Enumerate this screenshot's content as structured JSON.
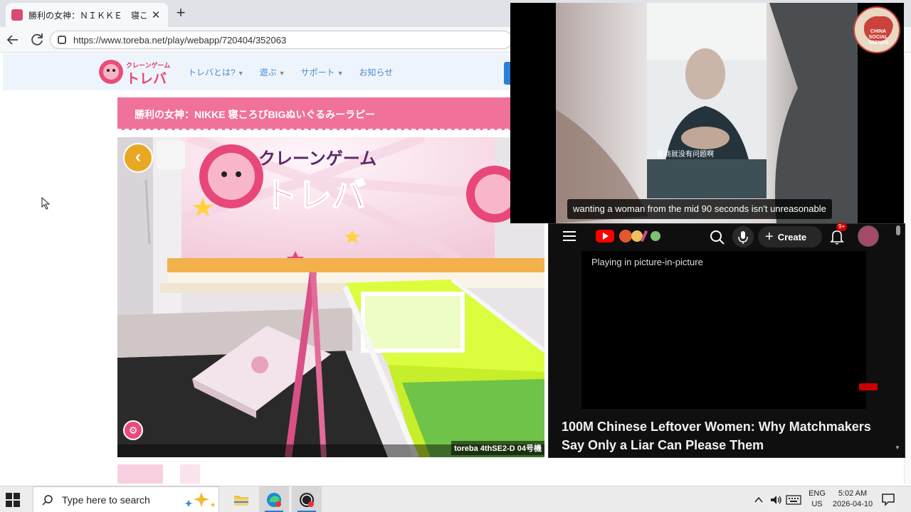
{
  "browser": {
    "tab_title": "勝利の女神：ＮＩＫＫＥ　寝ころび",
    "tab_close": "✕",
    "new_tab": "+",
    "url": "https://www.toreba.net/play/webapp/720404/352063"
  },
  "site": {
    "logo_top": "クレーンゲーム",
    "logo_main": "トレバ",
    "nav": [
      {
        "label": "トレバとは?",
        "has_dropdown": true
      },
      {
        "label": "遊ぶ",
        "has_dropdown": true
      },
      {
        "label": "サポート",
        "has_dropdown": true
      },
      {
        "label": "お知らせ",
        "has_dropdown": false
      }
    ],
    "title": "勝利の女神：NIKKE 寝ころびBIGぬいぐるみーラピー",
    "camera_label": "toreba 4thSE2-D 04号機",
    "game_sign_top": "クレーンゲーム",
    "game_sign_main": "トレバ",
    "back_glyph": "‹"
  },
  "pip": {
    "subtitle": "wanting a woman from the mid 90 seconds isn't unreasonable",
    "inner_subtitle": "智商就没有问题啊",
    "badge_line1": "CHINA",
    "badge_line2": "SOCIAL TRENDS"
  },
  "youtube": {
    "create_label": "Create",
    "notifications": "9+",
    "pip_status": "Playing in picture-in-picture",
    "video_title": "100M Chinese Leftover Women: Why Matchmakers Say Only a Liar Can Please Them"
  },
  "taskbar": {
    "search_placeholder": "Type here to search",
    "lang_line1": "ENG",
    "lang_line2": "US",
    "time": "5:02 AM",
    "date": "2026-04-10"
  },
  "colors": {
    "brand_pink": "#f0719a",
    "nav_blue": "#4c8cd1",
    "youtube_red": "#ff0000",
    "taskbar_accent": "#2b7bd3"
  }
}
